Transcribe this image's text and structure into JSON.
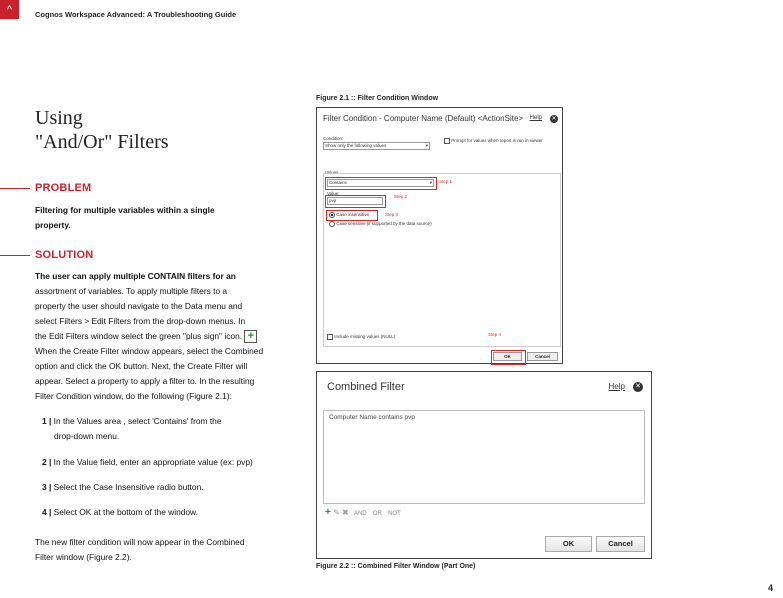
{
  "header": {
    "running_title": "Cognos Workspace Advanced: A Troubleshooting Guide",
    "corner_glyph": "^"
  },
  "title": {
    "line1": "Using",
    "line2": "\"And/Or\" Filters"
  },
  "problem": {
    "heading": "PROBLEM",
    "text_line1": "Filtering for multiple variables within a single",
    "text_line2": "property."
  },
  "solution": {
    "heading": "SOLUTION",
    "lines": [
      "The user can apply multiple CONTAIN filters for an",
      "assortment of variables.   To apply multiple filters to a",
      "property the user should navigate to the Data menu and",
      "select Filters > Edit Filters from the drop-down menus.  In",
      "the Edit Filters window select the green \"plus sign\" icon.",
      "When the Create Filter window appears, select the Combined",
      "option and click the OK button. Next, the Create Filter will",
      "appear. Select a property to apply a filter to.  In the resulting",
      "Filter Condition window, do the following (Figure 2.1):"
    ]
  },
  "steps": [
    {
      "num": "1 |",
      "text": "In the Values area , select 'Contains' from the",
      "text2": "drop-down menu."
    },
    {
      "num": "2 |",
      "text": "In the Value field, enter an appropriate value (ex: pvp)"
    },
    {
      "num": "3 |",
      "text": "Select the Case Insensitive radio button."
    },
    {
      "num": "4 |",
      "text": "Select OK at the bottom of the window."
    }
  ],
  "closing": {
    "line1": "The new filter condition will now appear in the Combined",
    "line2": "Filter window (Figure 2.2)."
  },
  "figure1": {
    "caption": "Figure 2.1 :: Filter Condition Window",
    "title": "Filter Condition - Computer Name (Default) <ActionSite>",
    "help": "Help",
    "condition_label": "Condition:",
    "condition_value": "Show only the following values",
    "prompt_label": "Prompt for values when report is run in viewer",
    "values_label": "Values",
    "operator_value": "Contains",
    "value_label": "Value:",
    "value_input": "pvp",
    "radio1": "Case insensitive",
    "radio2": "Case sensitive (if supported by the data source)",
    "include_missing": "Include missing values (NULL)",
    "step1": "Step 1",
    "step2": "Step 2",
    "step3": "Step 3",
    "step4": "Step 4",
    "ok": "OK",
    "cancel": "Cancel"
  },
  "figure2": {
    "caption": "Figure 2.2 :: Combined Filter Window (Part One)",
    "title": "Combined Filter",
    "help": "Help",
    "condition_item": "Computer Name contains pvp",
    "and": "AND",
    "or": "OR",
    "not": "NOT",
    "ok": "OK",
    "cancel": "Cancel"
  },
  "page_number": "4"
}
